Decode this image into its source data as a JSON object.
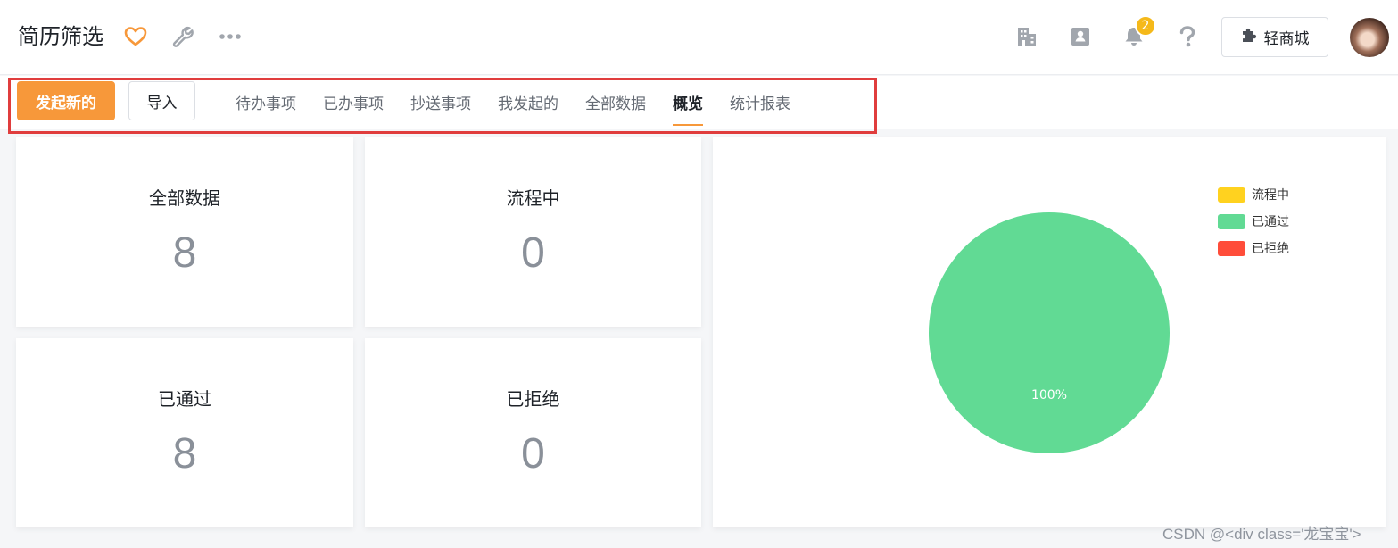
{
  "header": {
    "title": "简历筛选",
    "notification_count": "2",
    "mall_button_label": "轻商城",
    "icons": [
      "heart-icon",
      "wrench-icon",
      "more-icon",
      "building-icon",
      "contacts-icon",
      "bell-icon",
      "help-icon",
      "puzzle-icon"
    ]
  },
  "toolbar": {
    "new_button_label": "发起新的",
    "import_button_label": "导入",
    "tabs": [
      {
        "label": "待办事项"
      },
      {
        "label": "已办事项"
      },
      {
        "label": "抄送事项"
      },
      {
        "label": "我发起的"
      },
      {
        "label": "全部数据"
      },
      {
        "label": "概览"
      },
      {
        "label": "统计报表"
      }
    ],
    "active_tab": "概览"
  },
  "stats": [
    {
      "label": "全部数据",
      "value": "8"
    },
    {
      "label": "流程中",
      "value": "0"
    },
    {
      "label": "已通过",
      "value": "8"
    },
    {
      "label": "已拒绝",
      "value": "0"
    }
  ],
  "chart_data": {
    "type": "pie",
    "categories": [
      "流程中",
      "已通过",
      "已拒绝"
    ],
    "values": [
      0,
      8,
      0
    ],
    "colors": [
      "#ffd21f",
      "#61da94",
      "#ff4d3a"
    ],
    "data_labels": [
      "",
      "100%",
      ""
    ],
    "legend_position": "top-right"
  },
  "colors": {
    "accent": "#f7983a",
    "highlight_border": "#e03d3d",
    "badge": "#f5b91a"
  },
  "watermark": "CSDN @<div class='龙宝宝'>"
}
